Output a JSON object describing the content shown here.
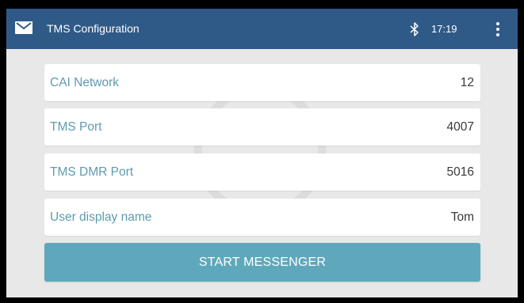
{
  "appbar": {
    "title": "TMS Configuration",
    "time": "17:19",
    "background": "#2f5a88",
    "icons": {
      "left": "mail-icon",
      "status": "bluetooth-icon",
      "menu": "overflow-menu-icon"
    }
  },
  "fields": [
    {
      "label": "CAI Network",
      "value": "12"
    },
    {
      "label": "TMS Port",
      "value": "4007"
    },
    {
      "label": "TMS DMR Port",
      "value": "5016"
    },
    {
      "label": "User display name",
      "value": "Tom"
    }
  ],
  "actions": {
    "start_label": "START MESSENGER",
    "start_color": "#5fa8bc"
  },
  "colors": {
    "label_text": "#5d9bb0",
    "value_text": "#3a3a3a",
    "background": "#e8e8e8"
  }
}
